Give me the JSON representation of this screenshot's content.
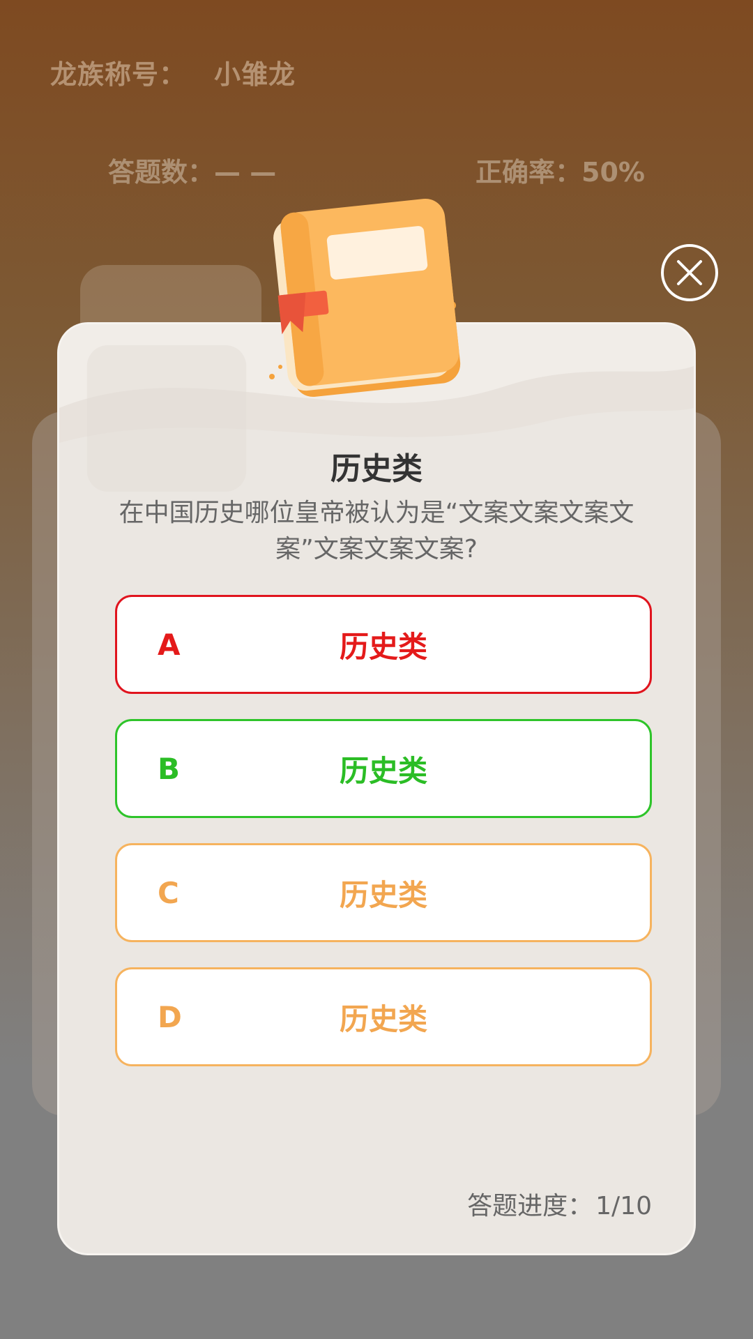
{
  "background": {
    "title_label": "龙族称号：",
    "title_value": "小雏龙",
    "answer_count_label": "答题数：",
    "answer_count_value": "— —",
    "accuracy_label": "正确率：",
    "accuracy_value": "50%"
  },
  "dialog": {
    "category": "历史类",
    "question": "在中国历史哪位皇帝被认为是“文案文案文案文案”文案文案文案?",
    "options": [
      {
        "letter": "A",
        "text": "历史类",
        "state": "wrong",
        "color": "#e41a1a"
      },
      {
        "letter": "B",
        "text": "历史类",
        "state": "correct",
        "color": "#2bbd25"
      },
      {
        "letter": "C",
        "text": "历史类",
        "state": "default",
        "color": "#f2a650"
      },
      {
        "letter": "D",
        "text": "历史类",
        "state": "default",
        "color": "#f2a650"
      }
    ],
    "progress_label": "答题进度：",
    "progress_value": "1/10"
  },
  "icons": {
    "close": "close-icon",
    "book": "book-icon"
  }
}
